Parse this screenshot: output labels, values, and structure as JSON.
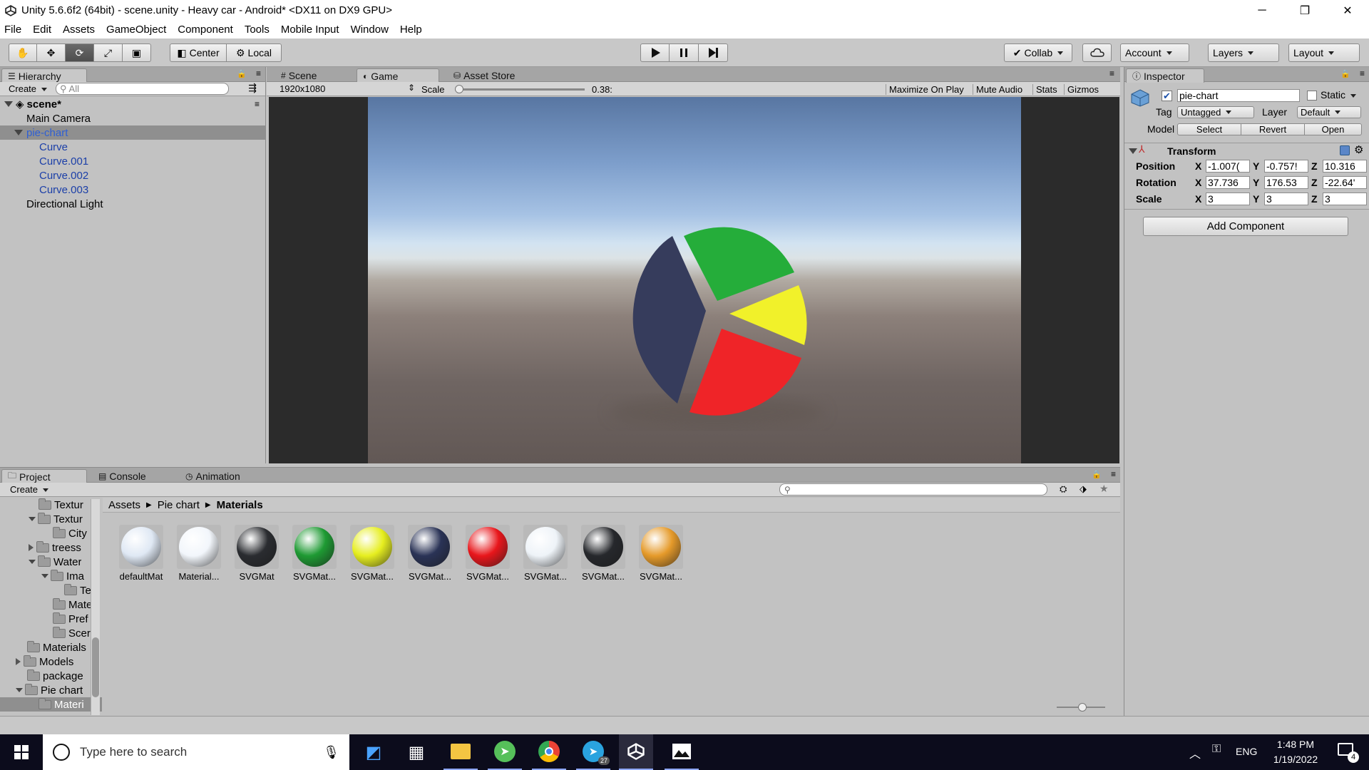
{
  "window": {
    "title": "Unity 5.6.6f2 (64bit) - scene.unity - Heavy car - Android* <DX11 on DX9 GPU>",
    "controls": [
      "─",
      "❐",
      "✕"
    ]
  },
  "menu": [
    "File",
    "Edit",
    "Assets",
    "GameObject",
    "Component",
    "Tools",
    "Mobile Input",
    "Window",
    "Help"
  ],
  "toolbar": {
    "center_label": "Center",
    "local_label": "Local",
    "collab_label": "Collab",
    "account_label": "Account",
    "layers_label": "Layers",
    "layout_label": "Layout"
  },
  "hierarchy": {
    "tab_label": "Hierarchy",
    "create_label": "Create",
    "search_placeholder": "All",
    "scene_name": "scene*",
    "items": [
      {
        "label": "Main Camera"
      },
      {
        "label": "pie-chart"
      },
      {
        "label": "Curve"
      },
      {
        "label": "Curve.001"
      },
      {
        "label": "Curve.002"
      },
      {
        "label": "Curve.003"
      },
      {
        "label": "Directional Light"
      }
    ]
  },
  "center": {
    "tabs": [
      {
        "label": "Scene"
      },
      {
        "label": "Game"
      },
      {
        "label": "Asset Store"
      }
    ],
    "resolution": "1920x1080",
    "scale_label": "Scale",
    "scale_value": "0.38:",
    "scale_level": 0.0,
    "toggles": [
      "Maximize On Play",
      "Mute Audio",
      "Stats",
      "Gizmos"
    ],
    "pie_colors": {
      "navy": "#363c5c",
      "green": "#25ad3a",
      "yellow": "#f1f12a",
      "red": "#ef2428"
    }
  },
  "inspector": {
    "tab_label": "Inspector",
    "object_name": "pie-chart",
    "static_label": "Static",
    "tag_label": "Tag",
    "tag_value": "Untagged",
    "layer_label": "Layer",
    "layer_value": "Default",
    "model_label": "Model",
    "model_buttons": [
      "Select",
      "Revert",
      "Open"
    ],
    "transform_label": "Transform",
    "rows": [
      {
        "label": "Position",
        "x": "-1.007(",
        "y": "-0.757!",
        "z": "10.316"
      },
      {
        "label": "Rotation",
        "x": "37.736",
        "y": "176.53",
        "z": "-22.64'"
      },
      {
        "label": "Scale",
        "x": "3",
        "y": "3",
        "z": "3"
      }
    ],
    "axis": [
      "X",
      "Y",
      "Z"
    ],
    "add_component_label": "Add Component"
  },
  "project": {
    "tabs": [
      {
        "label": "Project"
      },
      {
        "label": "Console"
      },
      {
        "label": "Animation"
      }
    ],
    "create_label": "Create",
    "breadcrumb": [
      "Assets",
      "Pie chart",
      "Materials"
    ],
    "tree": [
      {
        "label": "Textur"
      },
      {
        "label": "Textur"
      },
      {
        "label": "City"
      },
      {
        "label": "treess"
      },
      {
        "label": "Water"
      },
      {
        "label": "Ima"
      },
      {
        "label": "Te"
      },
      {
        "label": "Mate"
      },
      {
        "label": "Pref"
      },
      {
        "label": "Scer"
      },
      {
        "label": "Materials"
      },
      {
        "label": "Models"
      },
      {
        "label": "package"
      },
      {
        "label": "Pie chart"
      },
      {
        "label": "Materi"
      }
    ],
    "assets": [
      {
        "label": "defaultMat",
        "color": "#dfe8f4"
      },
      {
        "label": "Material...",
        "color": "#f2f6fb"
      },
      {
        "label": "SVGMat",
        "color": "#2a2c30"
      },
      {
        "label": "SVGMat...",
        "color": "#1e9a33"
      },
      {
        "label": "SVGMat...",
        "color": "#e6ee1f"
      },
      {
        "label": "SVGMat...",
        "color": "#2a3356"
      },
      {
        "label": "SVGMat...",
        "color": "#e8161b"
      },
      {
        "label": "SVGMat...",
        "color": "#eef3f8"
      },
      {
        "label": "SVGMat...",
        "color": "#26282c"
      },
      {
        "label": "SVGMat...",
        "color": "#e59a2a"
      }
    ]
  },
  "taskbar": {
    "search_placeholder": "Type here to search",
    "language": "ENG",
    "time": "1:48 PM",
    "date": "1/19/2022",
    "notification_count": "4",
    "telegram_badge": "27"
  }
}
